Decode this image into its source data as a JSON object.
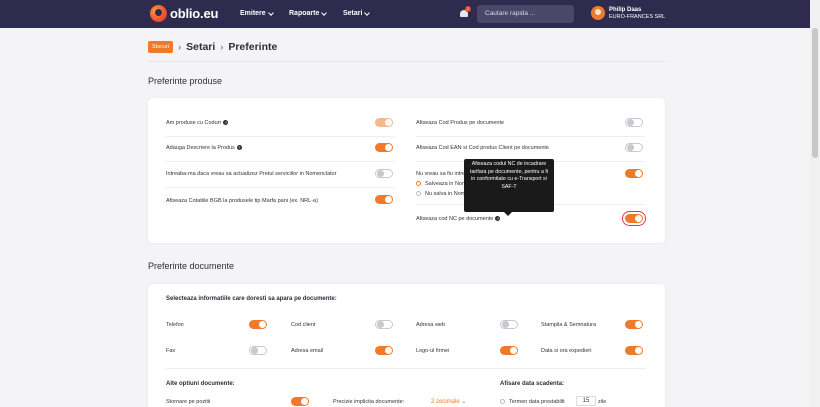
{
  "nav": {
    "logo_text": "oblio.eu",
    "items": [
      {
        "label": "Emitere"
      },
      {
        "label": "Rapoarte"
      },
      {
        "label": "Setari"
      }
    ],
    "notification_count": "2",
    "search_placeholder": "Cautare rapida ...",
    "user_name": "Philip Daas",
    "user_company": "EURO-FRANCES SRL"
  },
  "breadcrumb": {
    "back_label": "Stocuri",
    "items": [
      "Setari",
      "Preferinte"
    ]
  },
  "produse": {
    "title": "Preferinte produse",
    "left": [
      {
        "label": "Am produse cu Codurr",
        "help": true
      },
      {
        "label": "Adauga Descriere la Produs",
        "help": true
      },
      {
        "label": "Intreaba-ma daca vreau sa actualizez Pretul serviciilor in Nomenclator",
        "help": false
      },
      {
        "label": "Afiseaza Cotatiile BGB la produsele tip Marfa pani (ex. NRL-a)",
        "help": false
      }
    ],
    "right": [
      {
        "label": "Afiseaza Cod Produs pe documente"
      },
      {
        "label": "Afiseaza Cod EAN si Cod produs Client pe documente"
      },
      {
        "label": "Nu vreau sa fiu intrebat daca sa salvez produsele noi"
      },
      {
        "label": "Afiseaza cod NC pe documente"
      }
    ],
    "radio_options": [
      "Salveaza in Nomenclator",
      "Nu salva in Nomenclator"
    ],
    "tooltip": "Afiseaza codul NC de incadrare tarifara pe documente, pentru a fi in conformitate cu e-Transport si SAF-T"
  },
  "documente": {
    "title": "Preferinte documente",
    "subtitle": "Selecteaza informatiile care doresti sa apara pe documente:",
    "cols": [
      [
        {
          "label": "Telefon"
        },
        {
          "label": "Fax"
        }
      ],
      [
        {
          "label": "Cod client"
        },
        {
          "label": "Adresa email"
        }
      ],
      [
        {
          "label": "Adresa web"
        },
        {
          "label": "Logo-ul firmei"
        }
      ],
      [
        {
          "label": "Stampila & Semnatura"
        },
        {
          "label": "Data si ora expedieri"
        }
      ]
    ],
    "other_title": "Alte optiuni documente:",
    "stornare_label": "Stornare pe pozitii",
    "precizie_label": "Precizie implicita documente:",
    "precizie_value": "2 zecimale",
    "due_title": "Afisare data scadenta:",
    "due_label": "Termen data prestabilit",
    "due_value": "15",
    "due_suffix": "zile"
  },
  "colors": {
    "accent": "#f07a2b",
    "nav_bg": "#2e2b4f"
  }
}
